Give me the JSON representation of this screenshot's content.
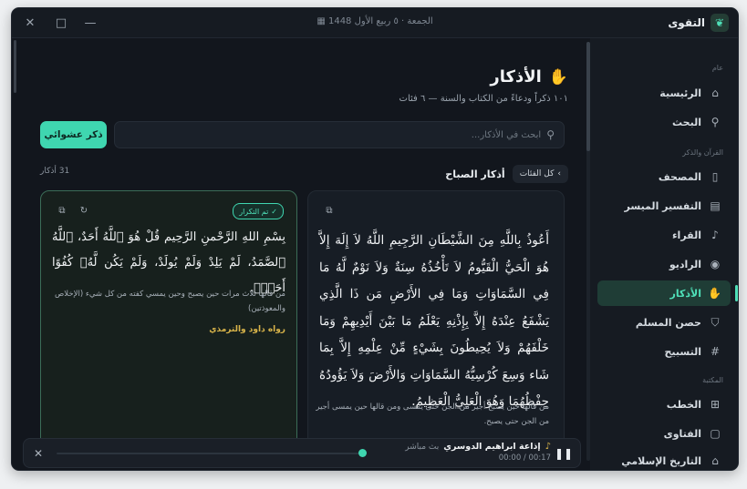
{
  "window": {
    "date": "الجمعة · ٥ ربيع الأول 1448",
    "brand": "التقوى",
    "controls": {
      "close": "✕",
      "maximize": "□",
      "minimize": "—"
    }
  },
  "sidebar": {
    "sections": [
      {
        "label": "عام"
      },
      {
        "label": "القرآن والذكر"
      },
      {
        "label": "المكتبة"
      }
    ],
    "items": [
      {
        "label": "الرئيسية",
        "icon": "home-icon"
      },
      {
        "label": "البحث",
        "icon": "search-icon"
      },
      {
        "label": "المصحف",
        "icon": "book-open-icon"
      },
      {
        "label": "التفسير الميسر",
        "icon": "book-icon"
      },
      {
        "label": "القراء",
        "icon": "microphone-icon"
      },
      {
        "label": "الراديو",
        "icon": "radio-icon"
      },
      {
        "label": "الأذكار",
        "icon": "hand-icon",
        "active": true
      },
      {
        "label": "حصن المسلم",
        "icon": "shield-icon"
      },
      {
        "label": "التسبيح",
        "icon": "hash-icon"
      },
      {
        "label": "الخطب",
        "icon": "podium-icon"
      },
      {
        "label": "الفتاوى",
        "icon": "book-icon"
      },
      {
        "label": "التاريخ الإسلامي",
        "icon": "landmark-icon"
      }
    ]
  },
  "main": {
    "title": "الأذكار",
    "subtitle": "١٠١ ذكراً ودعاءً من الكتاب والسنة — ٦ فئات",
    "search_placeholder": "ابحث في الأذكار...",
    "random_button": "ذكر عشوائي",
    "filter_chip": "كل الفئات",
    "category_title": "أذكار الصباح",
    "count": "31 أذكار"
  },
  "cards": [
    {
      "text": "أَعُوذُ بِاللَّهِ مِنَ الشَّيْطَانِ الرَّجِيمِ اللَّهُ لاَ إِلَهَ إِلاَّ هُوَ الْحَيُّ الْقَيُّومُ لاَ تَأْخُذُهُ سِنَةٌ وَلاَ نَوْمٌ لَّهُ مَا فِي السَّمَاوَاتِ وَمَا فِي الأَرْضِ مَن ذَا الَّذِي يَشْفَعُ عِنْدَهُ إِلاَّ بِإِذْنِهِ يَعْلَمُ مَا بَيْنَ أَيْدِيهِمْ وَمَا خَلْفَهُمْ وَلاَ يُحِيطُونَ بِشَيْءٍ مِّنْ عِلْمِهِ إِلاَّ بِمَا شَاء وَسِعَ كُرْسِيُّهُ السَّمَاوَاتِ وَالأَرْضَ وَلاَ يَؤُودُهُ حِفْظُهُمَا وَهُوَ الْعَلِيُّ الْعَظِيمُ.",
      "note": "من قالها حين يصبح أجير من الجن حتى يمسى ومن قالها حين يمسى أجير من الجن حتى يصبح."
    },
    {
      "badge": "تم التكرار",
      "text": "بِسْمِ اللهِ الرَّحْمنِ الرَّحِيم قُلْ هُوَ ٱللَّهُ أَحَدٌ، ٱللَّهُ ٱلصَّمَدُ، لَمْ يَلِدْ وَلَمْ يُولَدْ، وَلَمْ يَكُن لَّهُۥ كُفُوًا أَحَدٌۢ.",
      "note": "من قالها ثلاث مرات حين يصبح وحين يمسي كفته من كل شيء (الإخلاص والمعوذتين)",
      "source": "رواه داود والترمذي"
    }
  ],
  "player": {
    "title": "إذاعة ابراهيم الدوسري",
    "live": "بث مباشر",
    "time": "00:00 / 00:17",
    "progress": 0.92
  },
  "colors": {
    "accent": "#3fd6b0",
    "background": "#12161d",
    "sidebar": "#161b22",
    "gold": "#d9b44a"
  }
}
